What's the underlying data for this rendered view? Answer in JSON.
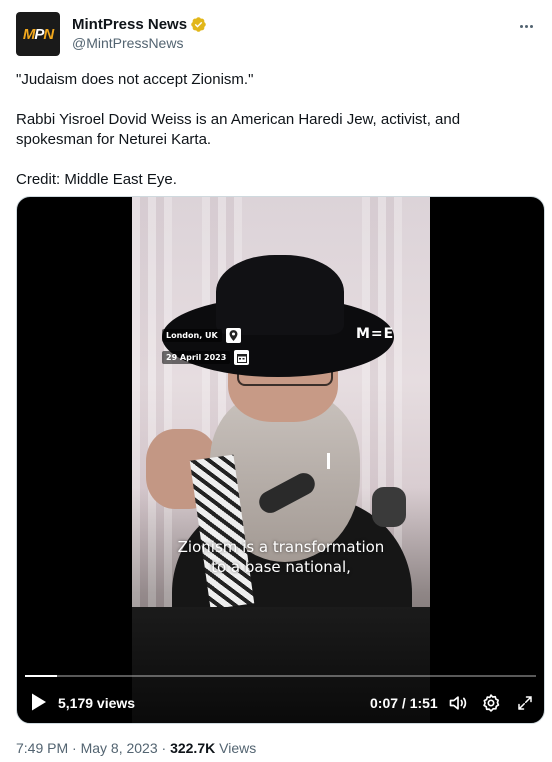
{
  "author": {
    "display_name": "MintPress News",
    "handle": "@MintPressNews",
    "avatar_text_a": "M",
    "avatar_text_b": "P",
    "avatar_text_c": "N",
    "verified_color": "#e2b719"
  },
  "tweet": {
    "line1": "\"Judaism does not accept Zionism.\"",
    "line2": "Rabbi Yisroel Dovid Weiss is an American Haredi Jew, activist, and spokesman for Neturei Karta.",
    "line3": "Credit: Middle East Eye."
  },
  "video": {
    "location": "London, UK",
    "date": "29 April 2023",
    "logo": "M=E",
    "caption_line1": "Zionism is a transformation",
    "caption_line2": "to a base national,",
    "views_label": "5,179 views",
    "time_label": "0:07 / 1:51",
    "progress": 0.063
  },
  "meta": {
    "timestamp": "7:49 PM · May 8, 2023 · ",
    "views_count": "322.7K",
    "views_word": " Views"
  },
  "colors": {
    "text_primary": "#0f1419",
    "text_secondary": "#536471"
  }
}
